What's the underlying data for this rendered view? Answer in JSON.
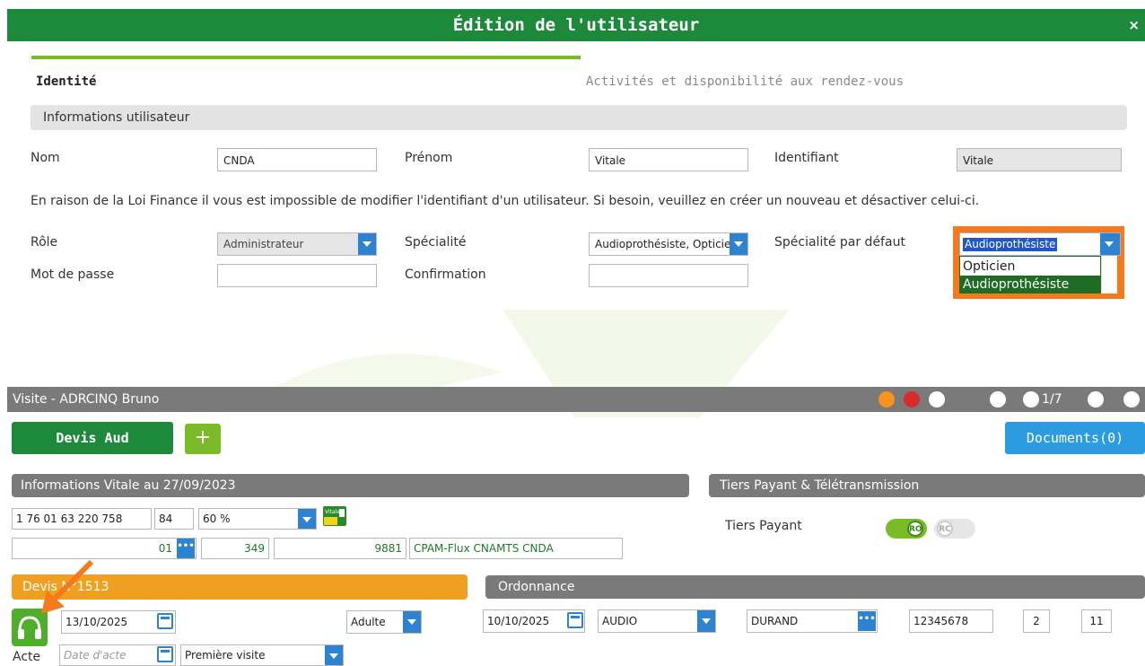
{
  "dialog": {
    "title": "Édition de l'utilisateur",
    "close": "×",
    "tabs": [
      {
        "label": "Identité",
        "active": true
      },
      {
        "label": "Activités et disponibilité aux rendez-vous",
        "active": false
      }
    ],
    "section_title": "Informations utilisateur",
    "fields": {
      "nom_label": "Nom",
      "nom_value": "CNDA",
      "prenom_label": "Prénom",
      "prenom_value": "Vitale",
      "identifiant_label": "Identifiant",
      "identifiant_value": "Vitale",
      "role_label": "Rôle",
      "role_value": "Administrateur",
      "specialite_label": "Spécialité",
      "specialite_value": "Audioprothésiste, Opticien",
      "specialite_defaut_label": "Spécialité par défaut",
      "specialite_defaut_value": "Audioprothésiste",
      "mot_de_passe_label": "Mot de passe",
      "confirmation_label": "Confirmation"
    },
    "notice": "En raison de la Loi Finance il vous est impossible de modifier l'identifiant d'un utilisateur. Si besoin, veuillez en créer un nouveau et désactiver celui-ci.",
    "dropdown_options": [
      "Opticien",
      "Audioprothésiste"
    ]
  },
  "visite": {
    "title": "Visite - ADRCINQ Bruno",
    "page": "1/7",
    "devis_button": "Devis Aud",
    "plus_button": "+",
    "documents_button": "Documents(0)",
    "vitale_section": "Informations Vitale au 27/09/2023",
    "vitale": {
      "nir": "1 76 01 63 220 758",
      "cle": "84",
      "taux": "60 %",
      "regime": "01",
      "caisse": "349",
      "centre": "9881",
      "organisme": "CPAM-Flux CNAMTS CNDA",
      "card_label": "Vitale"
    },
    "tiers_section": "Tiers Payant & Télétransmission",
    "tiers_label": "Tiers Payant",
    "toggle_ro": "RO",
    "toggle_rc": "RC",
    "devis_section": "Devis N°1513",
    "devis": {
      "date": "13/10/2025",
      "type": "Adulte",
      "acte_label": "Acte",
      "date_acte_placeholder": "Date d'acte",
      "visite_type": "Première visite"
    },
    "ordonnance_section": "Ordonnance",
    "ordonnance": {
      "date": "10/10/2025",
      "type": "AUDIO",
      "prescripteur": "DURAND",
      "numero": "12345678",
      "val1": "2",
      "val2": "11"
    }
  },
  "colors": {
    "primary_green": "#1c8a3a",
    "light_green": "#7cbb28",
    "orange": "#f47a1c",
    "blue": "#2d83cf",
    "grey_bar": "#7a7a7a"
  }
}
